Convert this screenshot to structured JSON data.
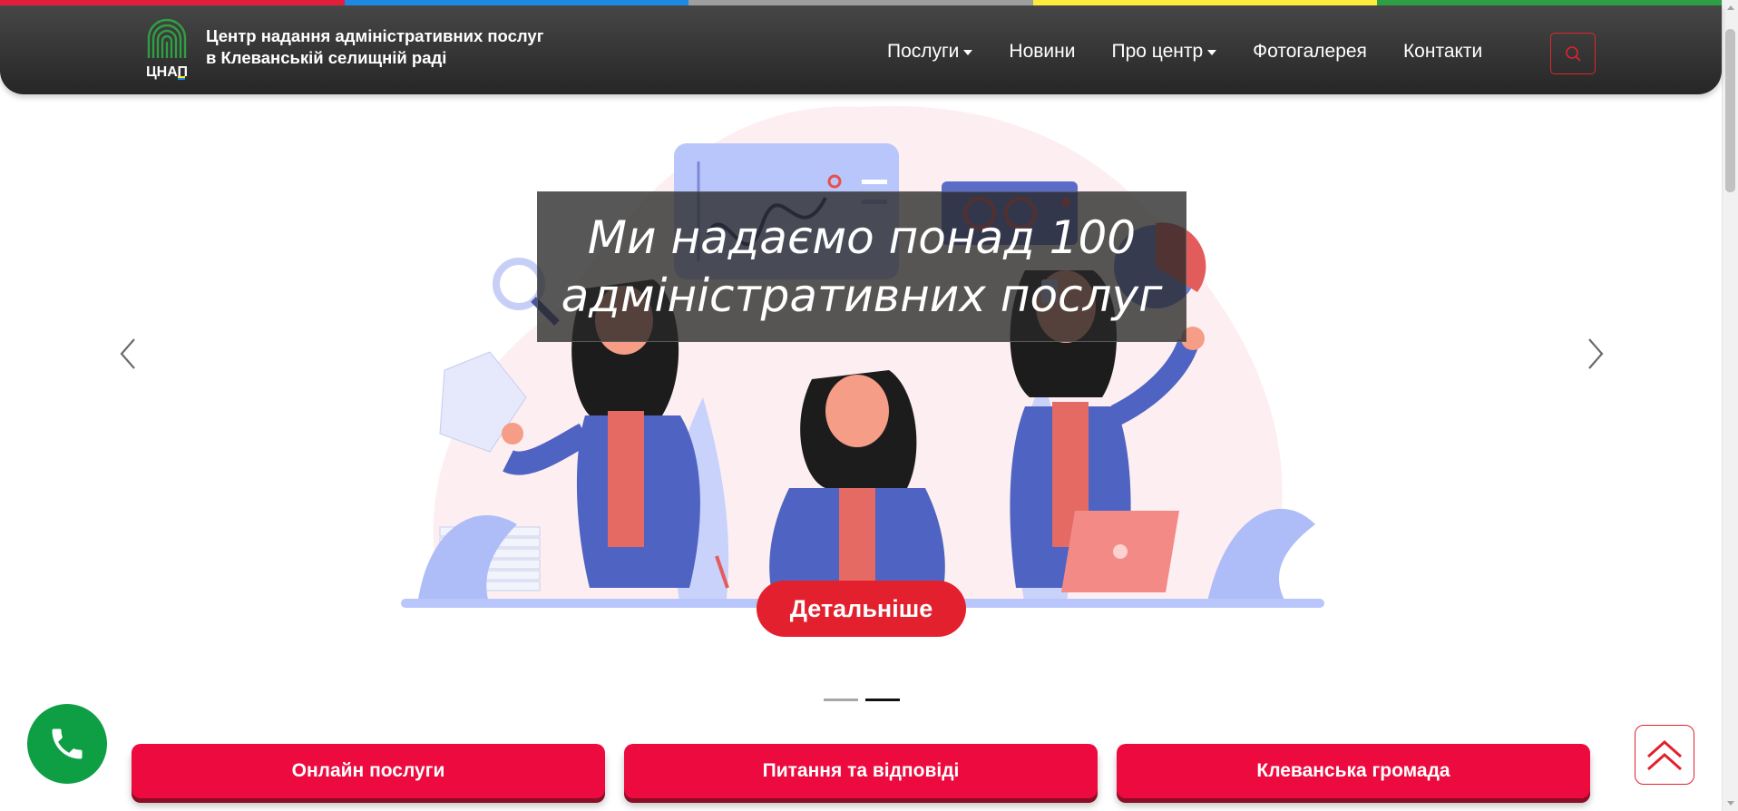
{
  "header": {
    "logo_text": "ЦНАП",
    "title_line1": "Центр надання адміністративних послуг",
    "title_line2": "в Клеванській селищній раді"
  },
  "nav": {
    "items": [
      {
        "label": "Послуги",
        "dropdown": true
      },
      {
        "label": "Новини",
        "dropdown": false
      },
      {
        "label": "Про центр",
        "dropdown": true
      },
      {
        "label": "Фотогалерея",
        "dropdown": false
      },
      {
        "label": "Контакти",
        "dropdown": false
      }
    ],
    "search_icon": "search-icon"
  },
  "carousel": {
    "caption_line1": "Ми надаємо понад 100",
    "caption_line2": "адміністративних послуг",
    "details_label": "Детальніше",
    "active_index": 1,
    "slide_count": 2
  },
  "bottom_buttons": [
    "Онлайн послуги",
    "Питання та відповіді",
    "Клеванська громада"
  ],
  "floating": {
    "phone_icon": "phone-icon",
    "scroll_up_icon": "double-chevron-up-icon"
  },
  "colors": {
    "strip": [
      "#e31e3b",
      "#1e88e5",
      "#9e9e9e",
      "#ffeb3b",
      "#2e9e45"
    ],
    "accent_red": "#e3202e",
    "button_red": "#ec0a3e",
    "phone_green": "#0e9f45",
    "header_dark": "#333333"
  }
}
